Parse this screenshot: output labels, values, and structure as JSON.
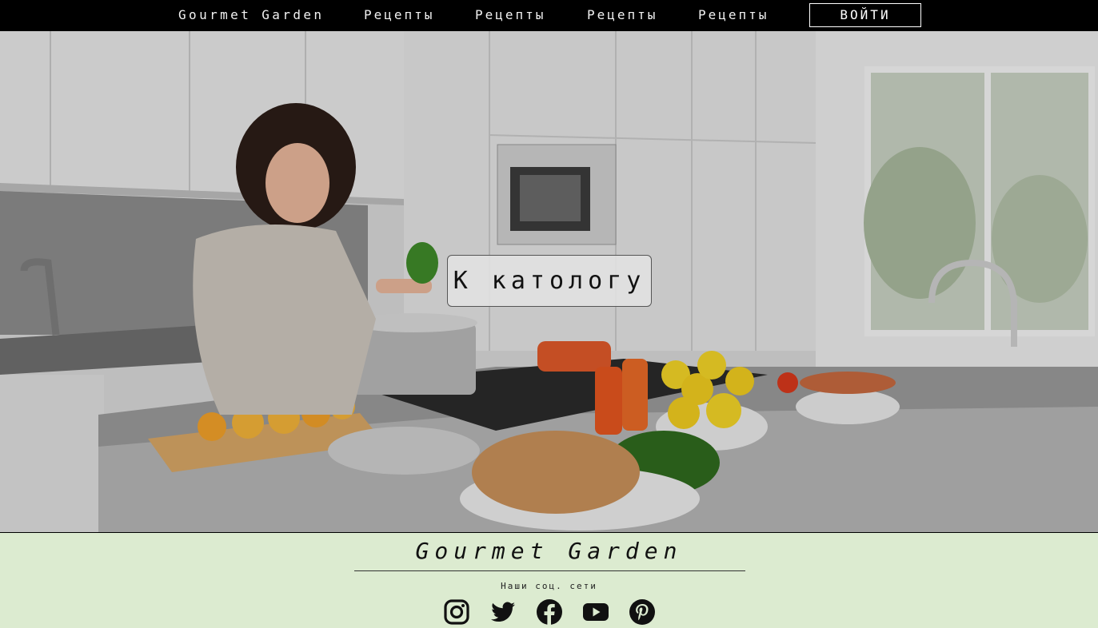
{
  "nav": {
    "brand": "Gourmet Garden",
    "items": [
      "Рецепты",
      "Рецепты",
      "Рецепты",
      "Рецепты"
    ],
    "login": "ВОЙТИ"
  },
  "hero": {
    "catalog_button": "К катологу"
  },
  "footer": {
    "title": "Gourmet Garden",
    "social_label": "Наши соц. сети",
    "social_icons": [
      "instagram-icon",
      "twitter-icon",
      "facebook-icon",
      "youtube-icon",
      "pinterest-icon"
    ]
  },
  "colors": {
    "nav_bg": "#000000",
    "footer_bg": "#dcebd0"
  }
}
